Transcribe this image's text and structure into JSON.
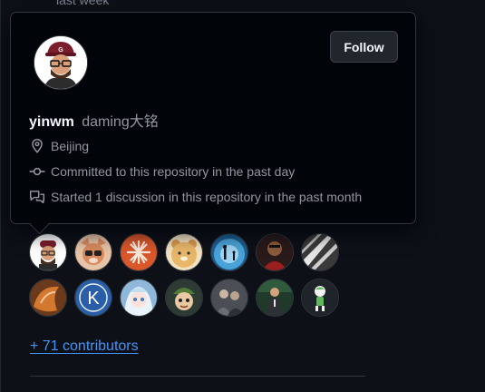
{
  "page": {
    "faded_top_text": "last week"
  },
  "hovercard": {
    "login": "yinwm",
    "full_name": "daming大铭",
    "follow_label": "Follow",
    "location": "Beijing",
    "activity": [
      {
        "icon": "commit-icon",
        "text": "Committed to this repository in the past day"
      },
      {
        "icon": "discussion-icon",
        "text": "Started 1 discussion in this repository in the past month"
      }
    ]
  },
  "contributors": {
    "more_label": "+ 71 contributors",
    "avatars": [
      {
        "name": "yinwm",
        "color": "#ffffff"
      },
      {
        "name": "contributor-2",
        "color": "#d98b5f"
      },
      {
        "name": "contributor-3",
        "color": "#d9572b"
      },
      {
        "name": "contributor-4",
        "color": "#e8b76a"
      },
      {
        "name": "contributor-5",
        "color": "#4aa3d8"
      },
      {
        "name": "contributor-6",
        "color": "#9b1f1f"
      },
      {
        "name": "contributor-7",
        "color": "#3a3a3a"
      },
      {
        "name": "contributor-8",
        "color": "#d2782f"
      },
      {
        "name": "contributor-9",
        "color": "#2b5ea8"
      },
      {
        "name": "contributor-10",
        "color": "#bfe0f0"
      },
      {
        "name": "contributor-11",
        "color": "#2e3b34"
      },
      {
        "name": "contributor-12",
        "color": "#4b4f55"
      },
      {
        "name": "contributor-13",
        "color": "#1f3a2a"
      },
      {
        "name": "contributor-14",
        "color": "#1f242b"
      }
    ]
  }
}
